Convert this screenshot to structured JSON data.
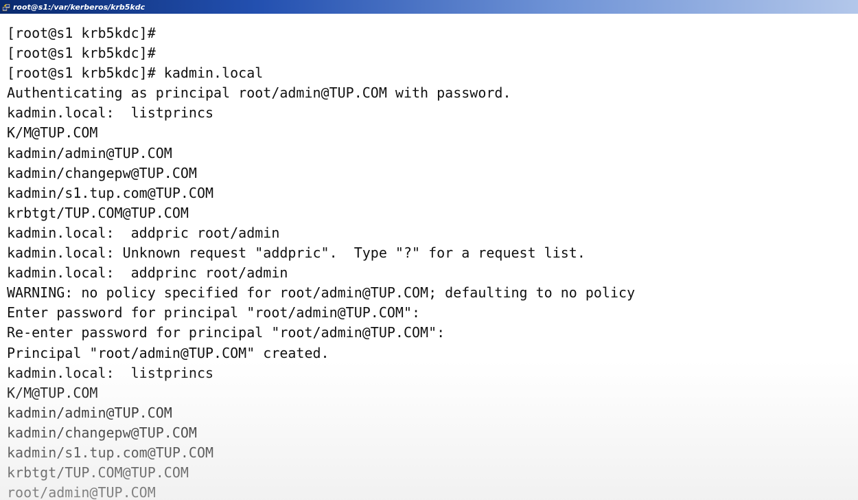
{
  "window": {
    "title": "root@s1:/var/kerberos/krb5kdc",
    "icon": "putty-terminal-icon"
  },
  "terminal": {
    "lines": [
      "[root@s1 krb5kdc]#",
      "[root@s1 krb5kdc]#",
      "[root@s1 krb5kdc]# kadmin.local",
      "Authenticating as principal root/admin@TUP.COM with password.",
      "kadmin.local:  listprincs",
      "K/M@TUP.COM",
      "kadmin/admin@TUP.COM",
      "kadmin/changepw@TUP.COM",
      "kadmin/s1.tup.com@TUP.COM",
      "krbtgt/TUP.COM@TUP.COM",
      "kadmin.local:  addpric root/admin",
      "kadmin.local: Unknown request \"addpric\".  Type \"?\" for a request list.",
      "kadmin.local:  addprinc root/admin",
      "WARNING: no policy specified for root/admin@TUP.COM; defaulting to no policy",
      "Enter password for principal \"root/admin@TUP.COM\":",
      "Re-enter password for principal \"root/admin@TUP.COM\":",
      "Principal \"root/admin@TUP.COM\" created.",
      "kadmin.local:  listprincs",
      "K/M@TUP.COM",
      "kadmin/admin@TUP.COM",
      "kadmin/changepw@TUP.COM",
      "kadmin/s1.tup.com@TUP.COM",
      "krbtgt/TUP.COM@TUP.COM",
      "root/admin@TUP.COM"
    ]
  },
  "colors": {
    "background": "#ffffff",
    "text": "#111111",
    "titlebar_start": "#0a2a6e",
    "titlebar_end": "#b3c7ea"
  }
}
